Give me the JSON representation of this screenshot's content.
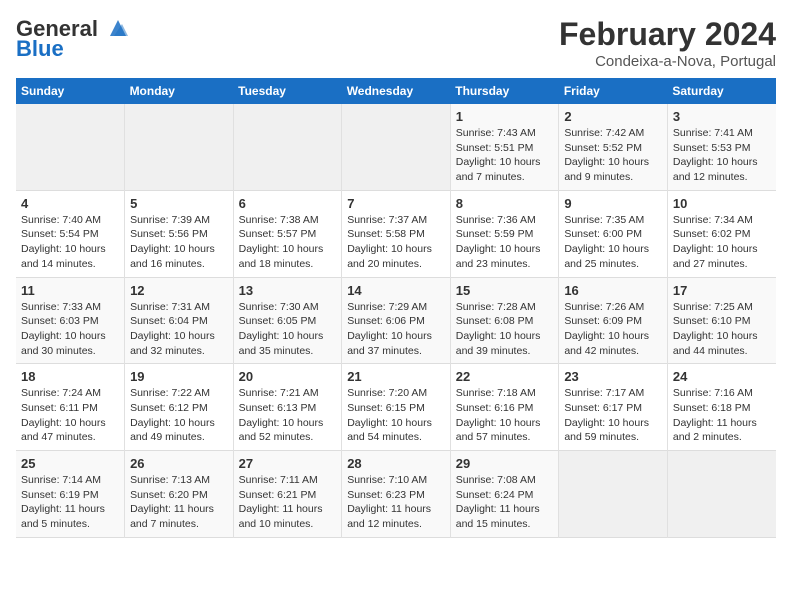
{
  "logo": {
    "line1": "General",
    "line2": "Blue"
  },
  "title": "February 2024",
  "subtitle": "Condeixa-a-Nova, Portugal",
  "weekdays": [
    "Sunday",
    "Monday",
    "Tuesday",
    "Wednesday",
    "Thursday",
    "Friday",
    "Saturday"
  ],
  "weeks": [
    [
      {
        "day": "",
        "info": ""
      },
      {
        "day": "",
        "info": ""
      },
      {
        "day": "",
        "info": ""
      },
      {
        "day": "",
        "info": ""
      },
      {
        "day": "1",
        "info": "Sunrise: 7:43 AM\nSunset: 5:51 PM\nDaylight: 10 hours\nand 7 minutes."
      },
      {
        "day": "2",
        "info": "Sunrise: 7:42 AM\nSunset: 5:52 PM\nDaylight: 10 hours\nand 9 minutes."
      },
      {
        "day": "3",
        "info": "Sunrise: 7:41 AM\nSunset: 5:53 PM\nDaylight: 10 hours\nand 12 minutes."
      }
    ],
    [
      {
        "day": "4",
        "info": "Sunrise: 7:40 AM\nSunset: 5:54 PM\nDaylight: 10 hours\nand 14 minutes."
      },
      {
        "day": "5",
        "info": "Sunrise: 7:39 AM\nSunset: 5:56 PM\nDaylight: 10 hours\nand 16 minutes."
      },
      {
        "day": "6",
        "info": "Sunrise: 7:38 AM\nSunset: 5:57 PM\nDaylight: 10 hours\nand 18 minutes."
      },
      {
        "day": "7",
        "info": "Sunrise: 7:37 AM\nSunset: 5:58 PM\nDaylight: 10 hours\nand 20 minutes."
      },
      {
        "day": "8",
        "info": "Sunrise: 7:36 AM\nSunset: 5:59 PM\nDaylight: 10 hours\nand 23 minutes."
      },
      {
        "day": "9",
        "info": "Sunrise: 7:35 AM\nSunset: 6:00 PM\nDaylight: 10 hours\nand 25 minutes."
      },
      {
        "day": "10",
        "info": "Sunrise: 7:34 AM\nSunset: 6:02 PM\nDaylight: 10 hours\nand 27 minutes."
      }
    ],
    [
      {
        "day": "11",
        "info": "Sunrise: 7:33 AM\nSunset: 6:03 PM\nDaylight: 10 hours\nand 30 minutes."
      },
      {
        "day": "12",
        "info": "Sunrise: 7:31 AM\nSunset: 6:04 PM\nDaylight: 10 hours\nand 32 minutes."
      },
      {
        "day": "13",
        "info": "Sunrise: 7:30 AM\nSunset: 6:05 PM\nDaylight: 10 hours\nand 35 minutes."
      },
      {
        "day": "14",
        "info": "Sunrise: 7:29 AM\nSunset: 6:06 PM\nDaylight: 10 hours\nand 37 minutes."
      },
      {
        "day": "15",
        "info": "Sunrise: 7:28 AM\nSunset: 6:08 PM\nDaylight: 10 hours\nand 39 minutes."
      },
      {
        "day": "16",
        "info": "Sunrise: 7:26 AM\nSunset: 6:09 PM\nDaylight: 10 hours\nand 42 minutes."
      },
      {
        "day": "17",
        "info": "Sunrise: 7:25 AM\nSunset: 6:10 PM\nDaylight: 10 hours\nand 44 minutes."
      }
    ],
    [
      {
        "day": "18",
        "info": "Sunrise: 7:24 AM\nSunset: 6:11 PM\nDaylight: 10 hours\nand 47 minutes."
      },
      {
        "day": "19",
        "info": "Sunrise: 7:22 AM\nSunset: 6:12 PM\nDaylight: 10 hours\nand 49 minutes."
      },
      {
        "day": "20",
        "info": "Sunrise: 7:21 AM\nSunset: 6:13 PM\nDaylight: 10 hours\nand 52 minutes."
      },
      {
        "day": "21",
        "info": "Sunrise: 7:20 AM\nSunset: 6:15 PM\nDaylight: 10 hours\nand 54 minutes."
      },
      {
        "day": "22",
        "info": "Sunrise: 7:18 AM\nSunset: 6:16 PM\nDaylight: 10 hours\nand 57 minutes."
      },
      {
        "day": "23",
        "info": "Sunrise: 7:17 AM\nSunset: 6:17 PM\nDaylight: 10 hours\nand 59 minutes."
      },
      {
        "day": "24",
        "info": "Sunrise: 7:16 AM\nSunset: 6:18 PM\nDaylight: 11 hours\nand 2 minutes."
      }
    ],
    [
      {
        "day": "25",
        "info": "Sunrise: 7:14 AM\nSunset: 6:19 PM\nDaylight: 11 hours\nand 5 minutes."
      },
      {
        "day": "26",
        "info": "Sunrise: 7:13 AM\nSunset: 6:20 PM\nDaylight: 11 hours\nand 7 minutes."
      },
      {
        "day": "27",
        "info": "Sunrise: 7:11 AM\nSunset: 6:21 PM\nDaylight: 11 hours\nand 10 minutes."
      },
      {
        "day": "28",
        "info": "Sunrise: 7:10 AM\nSunset: 6:23 PM\nDaylight: 11 hours\nand 12 minutes."
      },
      {
        "day": "29",
        "info": "Sunrise: 7:08 AM\nSunset: 6:24 PM\nDaylight: 11 hours\nand 15 minutes."
      },
      {
        "day": "",
        "info": ""
      },
      {
        "day": "",
        "info": ""
      }
    ]
  ]
}
